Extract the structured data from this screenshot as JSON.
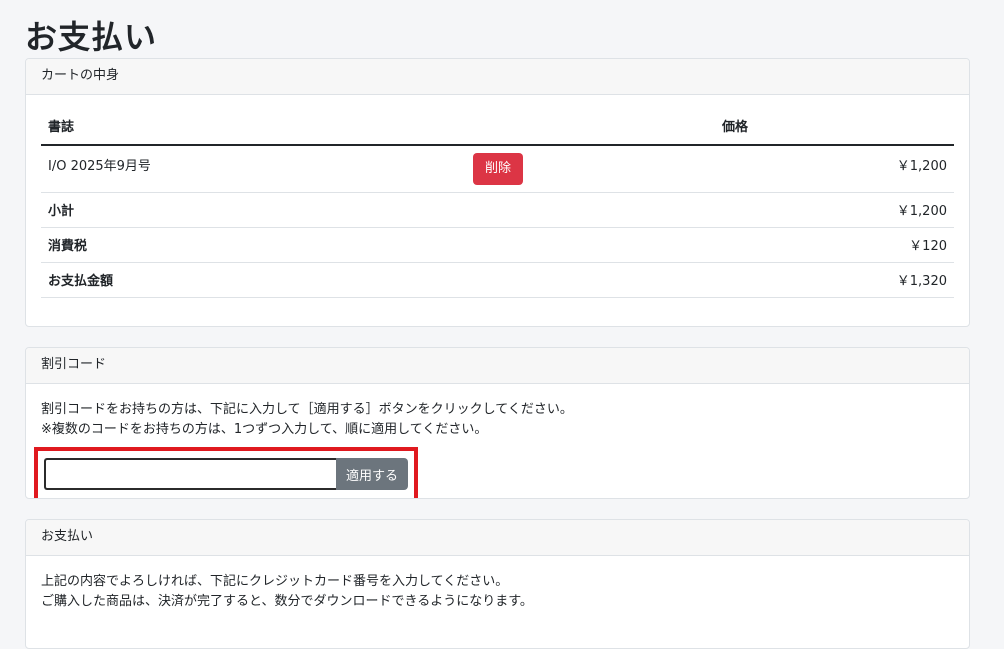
{
  "page_title": "お支払い",
  "cart": {
    "header": "カートの中身",
    "columns": {
      "title": "書誌",
      "price": "価格"
    },
    "items": [
      {
        "title": "I/O 2025年9月号",
        "delete_label": "削除",
        "price": "￥1,200"
      }
    ],
    "subtotal": {
      "label": "小計",
      "value": "￥1,200"
    },
    "tax": {
      "label": "消費税",
      "value": "￥120"
    },
    "total": {
      "label": "お支払金額",
      "value": "￥1,320"
    }
  },
  "coupon": {
    "header": "割引コード",
    "line1": "割引コードをお持ちの方は、下記に入力して［適用する］ボタンをクリックしてください。",
    "line2": "※複数のコードをお持ちの方は、1つずつ入力して、順に適用してください。",
    "input_value": "",
    "apply_label": "適用する",
    "highlight_color": "#e0191f"
  },
  "payment": {
    "header": "お支払い",
    "line1": "上記の内容でよろしければ、下記にクレジットカード番号を入力してください。",
    "line2": "ご購入した商品は、決済が完了すると、数分でダウンロードできるようになります。"
  }
}
